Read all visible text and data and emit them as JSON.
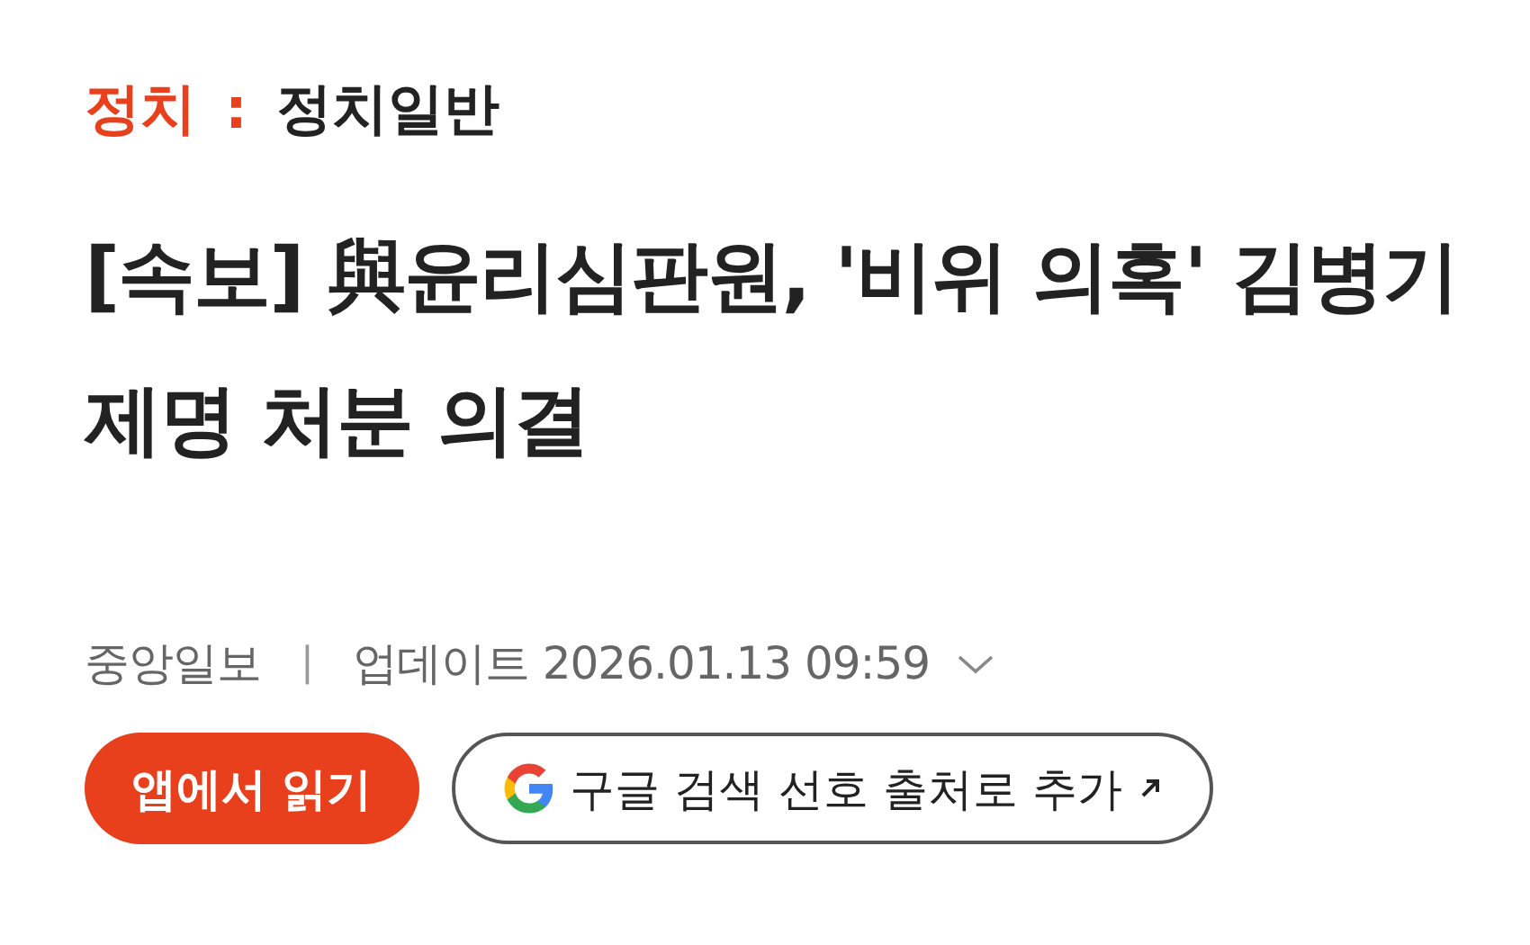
{
  "breadcrumb": {
    "section": "정치",
    "separator": ":",
    "subsection": "정치일반"
  },
  "headline": "[속보] 與윤리심판원, '비위 의혹' 김병기 제명 처분 의결",
  "meta": {
    "source": "중앙일보",
    "separator": "|",
    "updated": "업데이트 2026.01.13 09:59",
    "expanded": false
  },
  "buttons": [
    {
      "kind": "primary",
      "label": "앱에서 읽기"
    },
    {
      "kind": "google",
      "label": "구글 검색 선호 출처로 추가"
    }
  ]
}
